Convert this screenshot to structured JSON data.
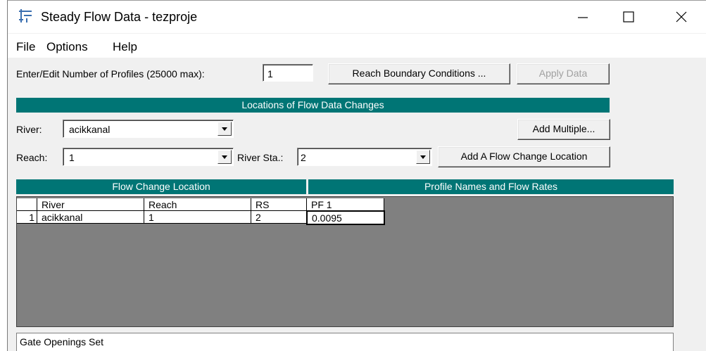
{
  "window": {
    "title": "Steady Flow Data - tezproje",
    "app_icon": "hec-ras-flow-icon",
    "controls": {
      "minimize": "─",
      "maximize": "☐",
      "close": "✕"
    }
  },
  "menu": {
    "items": [
      "File",
      "Options",
      "Help"
    ]
  },
  "profiles": {
    "label": "Enter/Edit Number of Profiles (25000 max):",
    "value": "1"
  },
  "buttons": {
    "reach_boundary": "Reach Boundary Conditions ...",
    "apply_data": "Apply Data",
    "add_multiple": "Add Multiple...",
    "add_flow_change": "Add A Flow Change Location"
  },
  "locations": {
    "header": "Locations of Flow Data Changes",
    "river_label": "River:",
    "river_value": "acikkanal",
    "reach_label": "Reach:",
    "reach_value": "1",
    "river_sta_label": "River Sta.:",
    "river_sta_value": "2"
  },
  "table": {
    "left_header": "Flow Change Location",
    "right_header": "Profile Names and Flow Rates",
    "columns": [
      "River",
      "Reach",
      "RS",
      "PF 1"
    ],
    "rows": [
      {
        "num": "1",
        "river": "acikkanal",
        "reach": "1",
        "rs": "2",
        "pf1": "0.0095"
      }
    ]
  },
  "status": {
    "text": "Gate Openings Set"
  }
}
